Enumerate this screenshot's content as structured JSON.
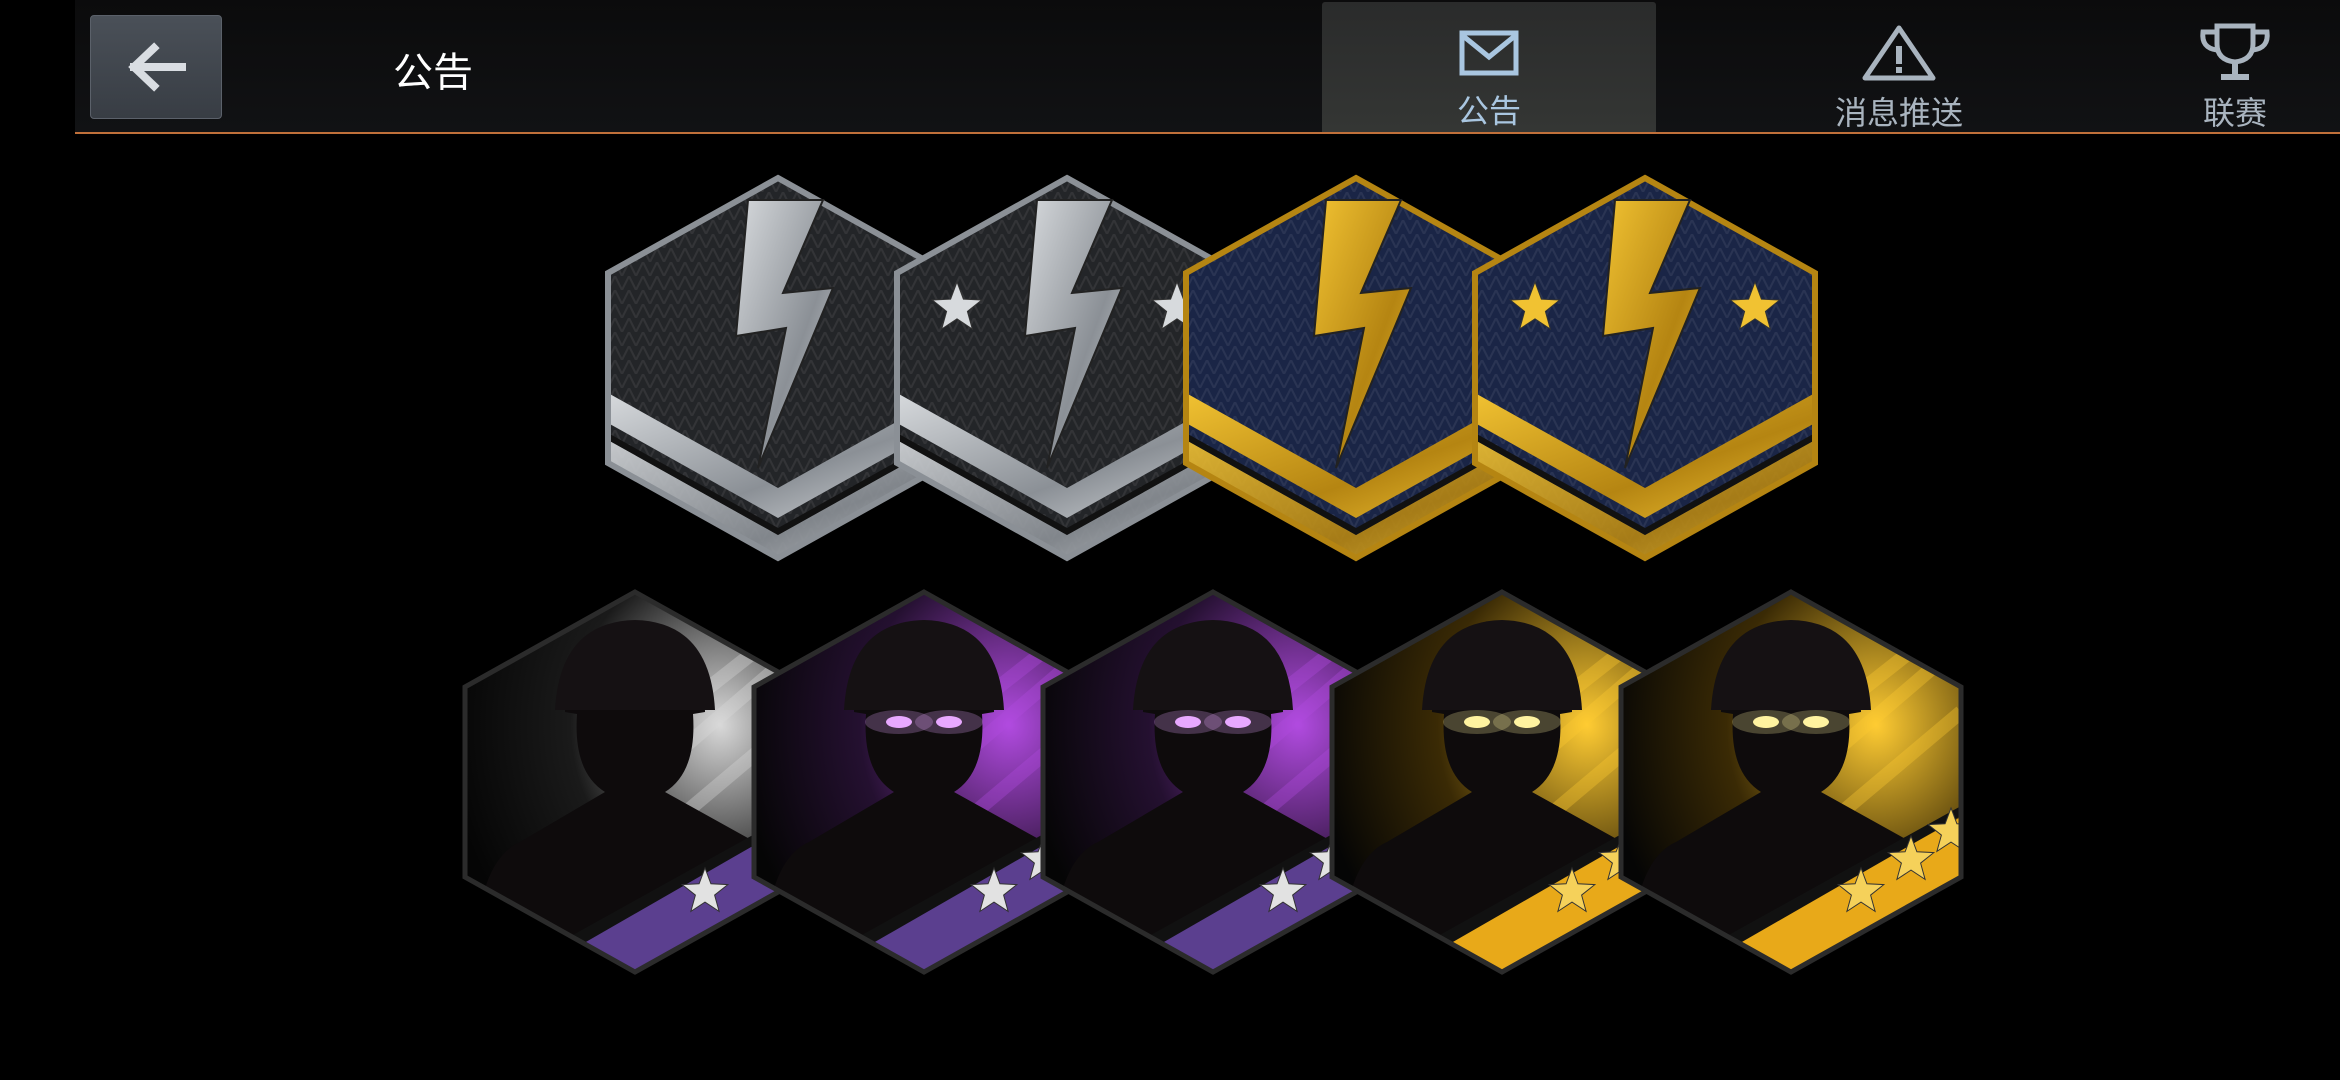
{
  "header": {
    "back_icon": "arrow-left-icon",
    "title": "公告"
  },
  "tabs": [
    {
      "id": "announcement",
      "label": "公告",
      "icon": "envelope-icon",
      "selected": true
    },
    {
      "id": "push",
      "label": "消息推送",
      "icon": "warning-triangle-icon",
      "selected": false
    },
    {
      "id": "league",
      "label": "联赛",
      "icon": "trophy-icon",
      "selected": false
    }
  ],
  "rank_badges": [
    {
      "metal": "silver",
      "stars": 0
    },
    {
      "metal": "silver",
      "stars": 2
    },
    {
      "metal": "gold",
      "stars": 0
    },
    {
      "metal": "gold",
      "stars": 2
    }
  ],
  "soldier_badges": [
    {
      "theme": "white",
      "stars": 1
    },
    {
      "theme": "purple",
      "stars": 2
    },
    {
      "theme": "purple",
      "stars": 3
    },
    {
      "theme": "gold",
      "stars": 2
    },
    {
      "theme": "gold",
      "stars": 3
    }
  ],
  "colors": {
    "accent_line": "#c0703a",
    "silver": "#d7dadd",
    "gold": "#f1c232",
    "purple_band": "#5b3f8f",
    "purple_glow": "#b14be0",
    "gold_glow": "#ffcc33",
    "navy": "#1a2546"
  }
}
